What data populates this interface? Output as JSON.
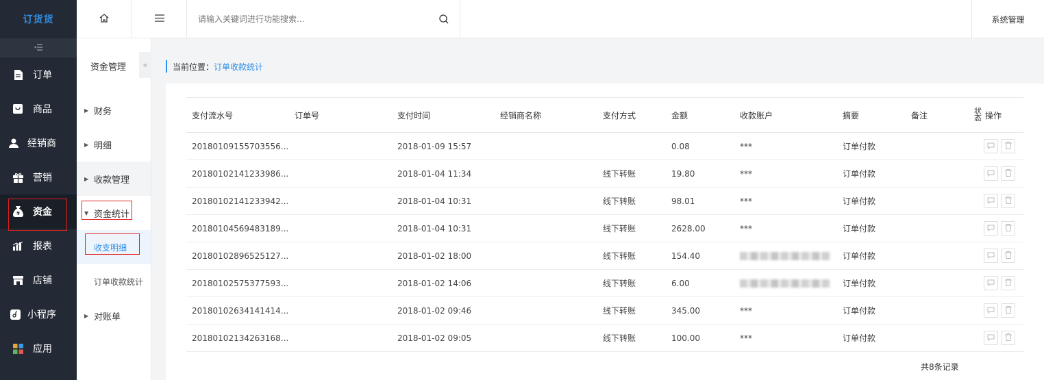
{
  "app": {
    "logo_text": "订货货"
  },
  "sidebar": {
    "items": [
      {
        "label": "订单",
        "icon": "document-icon"
      },
      {
        "label": "商品",
        "icon": "product-icon"
      },
      {
        "label": "经销商",
        "icon": "user-icon"
      },
      {
        "label": "营销",
        "icon": "gift-icon"
      },
      {
        "label": "资金",
        "icon": "money-bag-icon",
        "active": true
      },
      {
        "label": "报表",
        "icon": "bar-chart-icon"
      },
      {
        "label": "店铺",
        "icon": "store-icon"
      },
      {
        "label": "小程序",
        "icon": "mini-program-icon"
      },
      {
        "label": "应用",
        "icon": "apps-icon"
      }
    ]
  },
  "submenu": {
    "title": "资金管理",
    "items": [
      {
        "label": "财务"
      },
      {
        "label": "明细"
      },
      {
        "label": "收款管理"
      },
      {
        "label": "资金统计",
        "expanded": true
      },
      {
        "label": "对账单"
      }
    ],
    "children": [
      {
        "label": "收支明细",
        "active": true
      },
      {
        "label": "订单收款统计"
      }
    ]
  },
  "topbar": {
    "search_placeholder": "请输入关键词进行功能搜索...",
    "system_label": "系统管理"
  },
  "breadcrumb": {
    "prefix": "当前位置：",
    "current": "订单收款统计"
  },
  "table": {
    "headers": {
      "serial": "支付流水号",
      "order": "订单号",
      "time": "支付时间",
      "dealer": "经销商名称",
      "method": "支付方式",
      "amount": "金额",
      "account": "收款账户",
      "summary": "摘要",
      "remark": "备注",
      "state": "状态",
      "ops": "操作"
    },
    "rows": [
      {
        "serial": "20180109155703556...",
        "order": "",
        "time": "2018-01-09 15:57",
        "dealer": "",
        "method": "",
        "amount": "0.08",
        "account": "***",
        "summary": "订单付款",
        "remark": ""
      },
      {
        "serial": "20180102141233986...",
        "order": "",
        "time": "2018-01-04 11:34",
        "dealer": "",
        "method": "线下转账",
        "amount": "19.80",
        "account": "***",
        "summary": "订单付款",
        "remark": ""
      },
      {
        "serial": "20180102141233942...",
        "order": "",
        "time": "2018-01-04 10:31",
        "dealer": "",
        "method": "线下转账",
        "amount": "98.01",
        "account": "***",
        "summary": "订单付款",
        "remark": ""
      },
      {
        "serial": "20180104569483189...",
        "order": "",
        "time": "2018-01-04 10:31",
        "dealer": "",
        "method": "线下转账",
        "amount": "2628.00",
        "account": "***",
        "summary": "订单付款",
        "remark": ""
      },
      {
        "serial": "20180102896525127...",
        "order": "",
        "time": "2018-01-02 18:00",
        "dealer": "",
        "method": "线下转账",
        "amount": "154.40",
        "account": "",
        "summary": "订单付款",
        "remark": ""
      },
      {
        "serial": "20180102575377593...",
        "order": "",
        "time": "2018-01-02 14:06",
        "dealer": "",
        "method": "线下转账",
        "amount": "6.00",
        "account": "",
        "summary": "订单付款",
        "remark": ""
      },
      {
        "serial": "20180102634141414...",
        "order": "",
        "time": "2018-01-02 09:46",
        "dealer": "",
        "method": "线下转账",
        "amount": "345.00",
        "account": "***",
        "summary": "订单付款",
        "remark": ""
      },
      {
        "serial": "20180102134263168...",
        "order": "",
        "time": "2018-01-02 09:05",
        "dealer": "",
        "method": "线下转账",
        "amount": "100.00",
        "account": "***",
        "summary": "订单付款",
        "remark": ""
      }
    ],
    "total_text": "共8条记录"
  },
  "colors": {
    "accent": "#2f8fe8",
    "sidebar_bg": "#232a35",
    "highlight_border": "#e02020"
  }
}
